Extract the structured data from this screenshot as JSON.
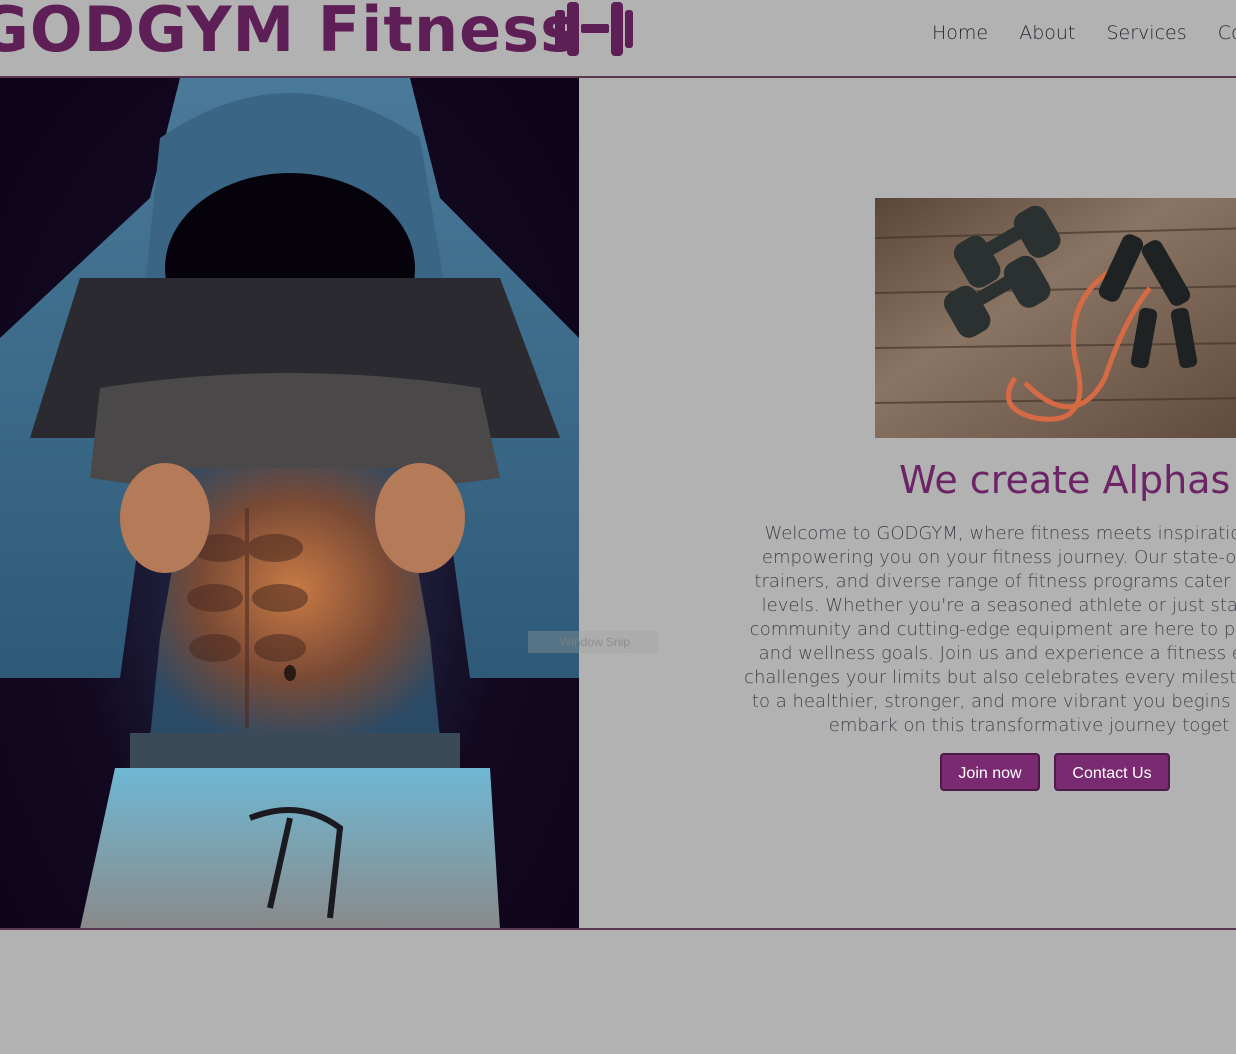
{
  "header": {
    "brand": "GODGYM Fitness",
    "logo_icon": "dumbbell-icon",
    "accent_color": "#5e1f57",
    "nav": [
      {
        "label": "Home"
      },
      {
        "label": "About"
      },
      {
        "label": "Services"
      },
      {
        "label": "Contact"
      }
    ]
  },
  "hero": {
    "image": "fitness-model-photo",
    "equipment_image": "dumbbells-and-resistance-band-photo",
    "headline": "We create Alphas",
    "welcome_lines": [
      "Welcome to GODGYM, where fitness meets inspiration! We",
      "empowering you on your fitness journey. Our state-of-the-a",
      "trainers, and diverse range of fitness programs cater to indiv",
      "levels. Whether you're a seasoned athlete or just starting o",
      "community and cutting-edge equipment are here to propel yo",
      "and wellness goals. Join us and experience a fitness environ",
      "challenges your limits but also celebrates every milestone alon",
      "to a healthier, stronger, and more vibrant you begins right he",
      "embark on this transformative journey toget"
    ],
    "join_label": "Join now",
    "contact_label": "Contact Us",
    "button_color": "#7a2a70"
  },
  "overlay": {
    "snip_label": "Window Snip"
  }
}
